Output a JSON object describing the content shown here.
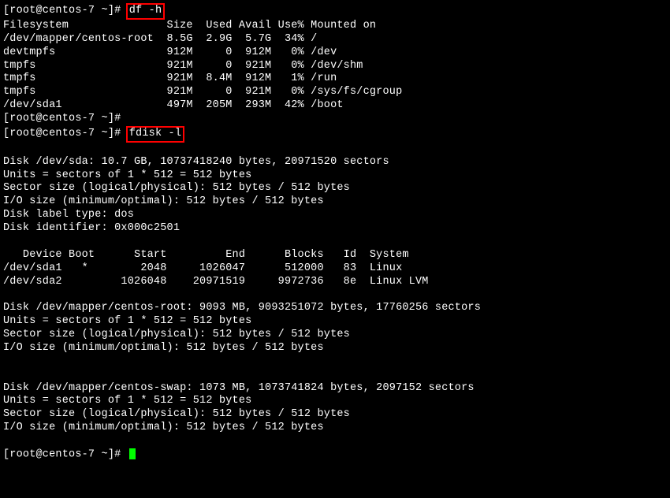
{
  "prompt_prefix": "[root@centos-7 ~]# ",
  "cmd1": "df -h",
  "cmd2": "fdisk -l",
  "df_header": "Filesystem               Size  Used Avail Use% Mounted on",
  "df_rows": [
    "/dev/mapper/centos-root  8.5G  2.9G  5.7G  34% /",
    "devtmpfs                 912M     0  912M   0% /dev",
    "tmpfs                    921M     0  921M   0% /dev/shm",
    "tmpfs                    921M  8.4M  912M   1% /run",
    "tmpfs                    921M     0  921M   0% /sys/fs/cgroup",
    "/dev/sda1                497M  205M  293M  42% /boot"
  ],
  "prompt_empty": "[root@centos-7 ~]#",
  "fdisk_sda": [
    "Disk /dev/sda: 10.7 GB, 10737418240 bytes, 20971520 sectors",
    "Units = sectors of 1 * 512 = 512 bytes",
    "Sector size (logical/physical): 512 bytes / 512 bytes",
    "I/O size (minimum/optimal): 512 bytes / 512 bytes",
    "Disk label type: dos",
    "Disk identifier: 0x000c2501"
  ],
  "part_header": "   Device Boot      Start         End      Blocks   Id  System",
  "part_rows": [
    "/dev/sda1   *        2048     1026047      512000   83  Linux",
    "/dev/sda2         1026048    20971519     9972736   8e  Linux LVM"
  ],
  "fdisk_root": [
    "Disk /dev/mapper/centos-root: 9093 MB, 9093251072 bytes, 17760256 sectors",
    "Units = sectors of 1 * 512 = 512 bytes",
    "Sector size (logical/physical): 512 bytes / 512 bytes",
    "I/O size (minimum/optimal): 512 bytes / 512 bytes"
  ],
  "fdisk_swap": [
    "Disk /dev/mapper/centos-swap: 1073 MB, 1073741824 bytes, 2097152 sectors",
    "Units = sectors of 1 * 512 = 512 bytes",
    "Sector size (logical/physical): 512 bytes / 512 bytes",
    "I/O size (minimum/optimal): 512 bytes / 512 bytes"
  ]
}
